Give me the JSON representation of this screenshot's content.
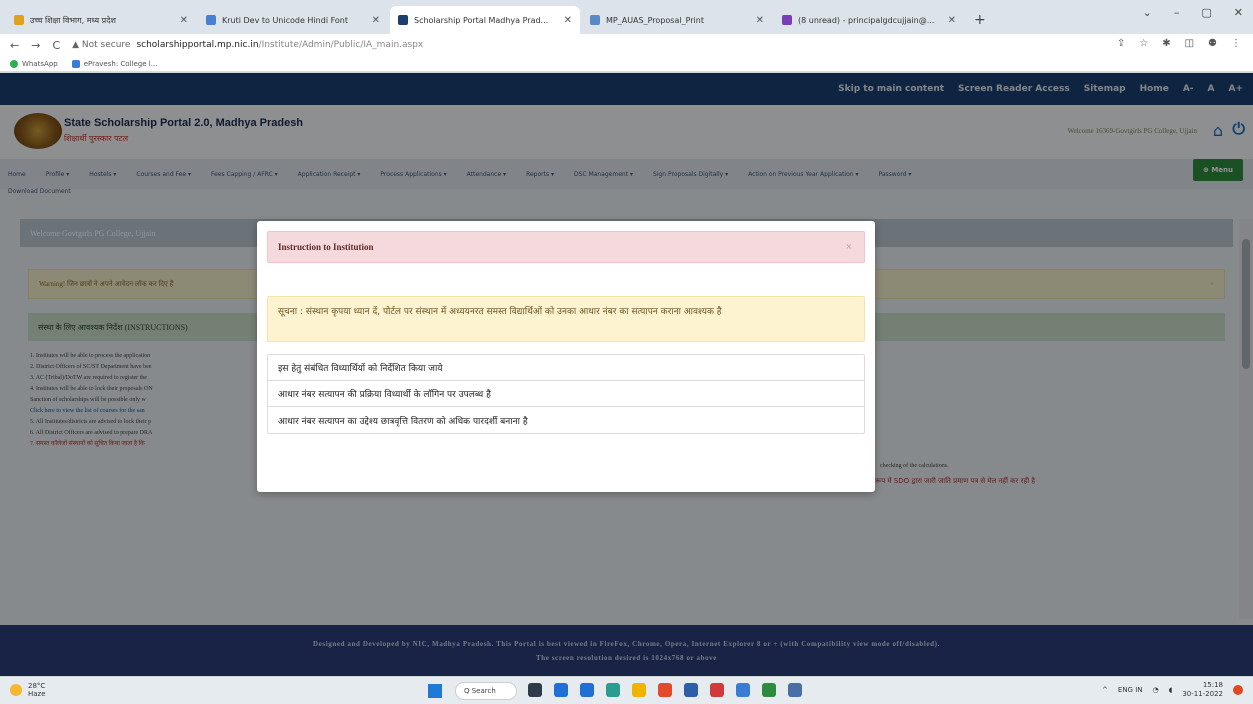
{
  "browser": {
    "tabs": [
      {
        "label": "उच्च शिक्षा विभाग, मध्य प्रदेश",
        "color": "#e0a020",
        "active": false
      },
      {
        "label": "Kruti Dev to Unicode Hindi Font",
        "color": "#4a7fd4",
        "active": false
      },
      {
        "label": "Scholarship Portal Madhya Prad...",
        "color": "#1a3f6e",
        "active": true
      },
      {
        "label": "MP_AUAS_Proposal_Print",
        "color": "#5a8ac6",
        "active": false
      },
      {
        "label": "(8 unread) - principalgdcujjain@...",
        "color": "#7a3fb8",
        "active": false
      }
    ],
    "new_tab": "+",
    "window_controls": [
      "⌄",
      "–",
      "▢",
      "✕"
    ],
    "nav": [
      "←",
      "→",
      "C"
    ],
    "not_secure": "▲ Not secure",
    "url_host": "scholarshipportal.mp.nic.in",
    "url_path": "/Institute/Admin/Public/IA_main.aspx",
    "addr_icons": [
      "⇪",
      "☆",
      "✱",
      "◫",
      "⚉",
      "⋮"
    ],
    "bookmarks": [
      {
        "label": "WhatsApp",
        "color": "#2bb24c"
      },
      {
        "label": "ePravesh: College l...",
        "color": "#3a7bd5"
      }
    ]
  },
  "site": {
    "top_links": [
      "Skip to main content",
      "Screen Reader Access",
      "Sitemap",
      "Home",
      "A-",
      "A",
      "A+"
    ],
    "portal_title": "State Scholarship Portal 2.0, Madhya Pradesh",
    "portal_sub": "शिक्षार्थी पुरस्कार पटल",
    "welcome_top": "Welcome 16369-Govtgirls PG College, Ujjain",
    "menu": [
      "Home",
      "Profile ▾",
      "Hostels ▾",
      "Courses and Fee ▾",
      "Fees Capping / AFRC ▾",
      "Application Receipt ▾",
      "Process Applications ▾",
      "Attendance ▾",
      "Reports ▾",
      "DSC Management ▾",
      "Sign Proposals Digitally ▾",
      "Action on Previous Year Application ▾",
      "Password ▾"
    ],
    "menu_row2": "Download Document",
    "menu_button": "⊕ Menu",
    "welcome_bar": "Welcome  Govtgirls PG College, Ujjain",
    "warning": "Warning! जिन छात्रों ने अपने आवेदन लॉक कर दिए हैं",
    "instructions_title": "संस्था के लिए आवश्यक निर्देश (INSTRUCTIONS)",
    "instructions": [
      "1. Institutes  will be able to process the application",
      "2. District Officers of  SC/ST Department have bee",
      "3. AC (Tribal)/DoTW are required  to register the",
      "4. Institutes will be able to lock their proposals  ON",
      "    Sanction of scholarships will be possible only w",
      "    Click here to view the list of courses for the san",
      "5. All Institutes/districts are advised to lock their p",
      "6. All District Officers are advised to prepare DRA",
      "7. समस्त कॉलेजों संस्थानों को सूचित किया जाता है कि"
    ],
    "right_note": "checking of the calculations.",
    "right_note2": "प्रारूप में SDO द्वारा जारी जाति प्रमाण पत्र से मेल नहीं कर रही है",
    "footer_line1": "Designed and Developed by NIC, Madhya Pradesh. This Portal is best viewed in FireFox, Chrome, Opera, Internet Explorer 8 or + (with Compatibility view mode off/disabled).",
    "footer_line2": "The screen resolution desired is 1024x768 or above"
  },
  "modal": {
    "title": "Instruction to Institution",
    "close": "×",
    "notice": "सूचना : संस्थान कृपया ध्यान दें, पोर्टल पर संस्थान में अध्ययनरत समस्त विद्यार्थिओं को उनका आधार नंबर का सत्यापन कराना आवश्यक है",
    "items": [
      "इस हेतु संबंधित विध्यार्थियों को निर्देशित किया जाये",
      "आधार नंबर सत्यापन की प्रक्रिया विध्यार्थी के लॉगिन पर उपलब्ध है",
      "आधार नंबर सत्यापन का उद्देश्य छात्रवृत्ति वितरण को अधिक पारदर्शी बनाना है"
    ]
  },
  "taskbar": {
    "temp": "28°C",
    "weather": "Haze",
    "search": "Q Search",
    "icon_colors": [
      "#2d3a4a",
      "#1f6fd6",
      "#1f6fd6",
      "#2a9d8f",
      "#f0b400",
      "#e24a2a",
      "#2c5fa8",
      "#d03a3a",
      "#3a7bd5",
      "#2e8b3e",
      "#4a6fa5"
    ],
    "tray_up": "^",
    "lang": "ENG IN",
    "time": "15:18",
    "date": "30-11-2022"
  }
}
